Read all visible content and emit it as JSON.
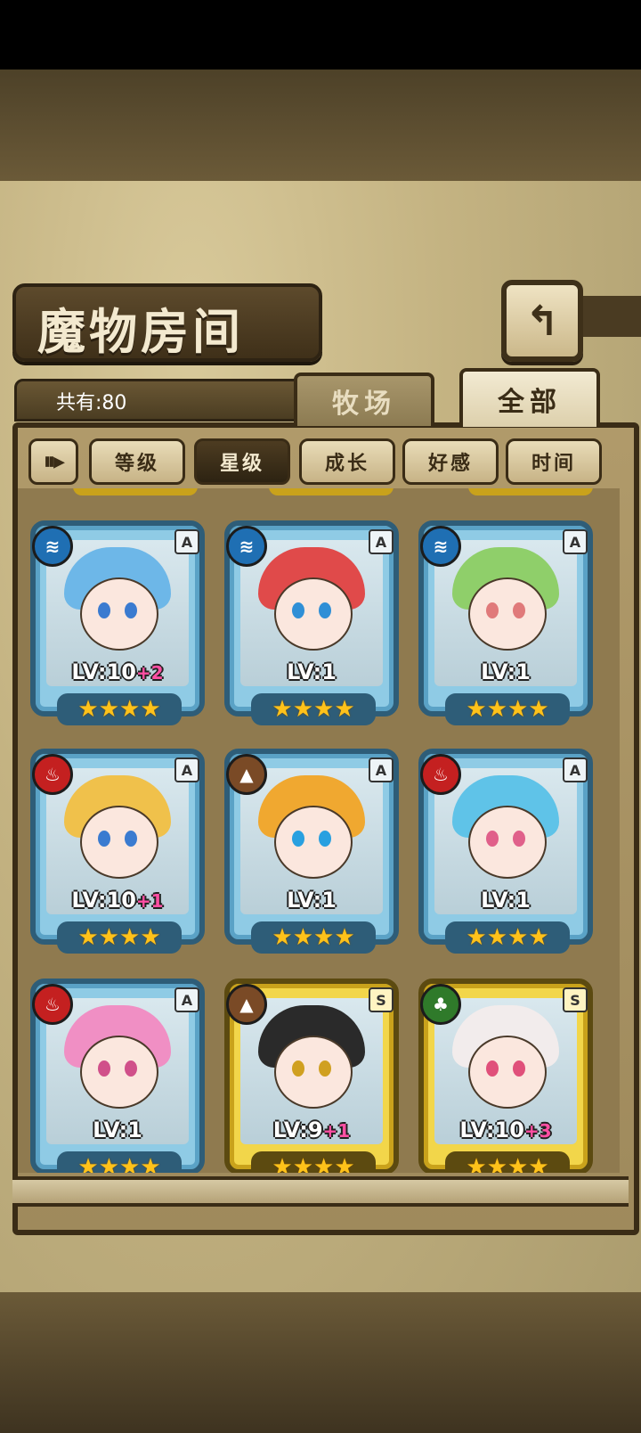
{
  "screen": {
    "title": "魔物房间",
    "back_icon": "return-arrow-icon",
    "count_label": "共有:80",
    "tabs": [
      {
        "label": "牧场",
        "active": false
      },
      {
        "label": "全部",
        "active": true
      }
    ],
    "sort_toggle_icon": "sort-direction-icon",
    "sort_buttons": [
      {
        "label": "等级",
        "active": false
      },
      {
        "label": "星级",
        "active": true
      },
      {
        "label": "成长",
        "active": false
      },
      {
        "label": "好感",
        "active": false
      },
      {
        "label": "时间",
        "active": false
      }
    ]
  },
  "colors": {
    "fire": "#c42020",
    "water": "#1f6fb3",
    "earth": "#7a4a26",
    "wood": "#2f7a2a"
  },
  "cards": [
    {
      "element": "water",
      "element_icon": "water-element-icon",
      "rank": "A",
      "level": "LV:10",
      "bonus": "+2",
      "stars": 4,
      "hair": "#6db7e8",
      "eyes": "#3a7bd0"
    },
    {
      "element": "water",
      "element_icon": "water-element-icon",
      "rank": "A",
      "level": "LV:1",
      "bonus": "",
      "stars": 4,
      "hair": "#e04a4a",
      "eyes": "#2f8fd6"
    },
    {
      "element": "water",
      "element_icon": "water-element-icon",
      "rank": "A",
      "level": "LV:1",
      "bonus": "",
      "stars": 4,
      "hair": "#8fcf6a",
      "eyes": "#e07a7a"
    },
    {
      "element": "fire",
      "element_icon": "fire-element-icon",
      "rank": "A",
      "level": "LV:10",
      "bonus": "+1",
      "stars": 4,
      "hair": "#f0c14b",
      "eyes": "#3a7bd0"
    },
    {
      "element": "earth",
      "element_icon": "earth-element-icon",
      "rank": "A",
      "level": "LV:1",
      "bonus": "",
      "stars": 4,
      "hair": "#f0a830",
      "eyes": "#28a0e0"
    },
    {
      "element": "fire",
      "element_icon": "fire-element-icon",
      "rank": "A",
      "level": "LV:1",
      "bonus": "",
      "stars": 4,
      "hair": "#5fc3e8",
      "eyes": "#e0608a"
    },
    {
      "element": "fire",
      "element_icon": "fire-element-icon",
      "rank": "A",
      "level": "LV:1",
      "bonus": "",
      "stars": 4,
      "hair": "#f08fc4",
      "eyes": "#d0508a"
    },
    {
      "element": "earth",
      "element_icon": "earth-element-icon",
      "rank": "S",
      "level": "LV:9",
      "bonus": "+1",
      "stars": 4,
      "hair": "#2a2a2a",
      "eyes": "#d0a020"
    },
    {
      "element": "wood",
      "element_icon": "wood-element-icon",
      "rank": "S",
      "level": "LV:10",
      "bonus": "+3",
      "stars": 4,
      "hair": "#f2ecec",
      "eyes": "#e0507a"
    }
  ]
}
